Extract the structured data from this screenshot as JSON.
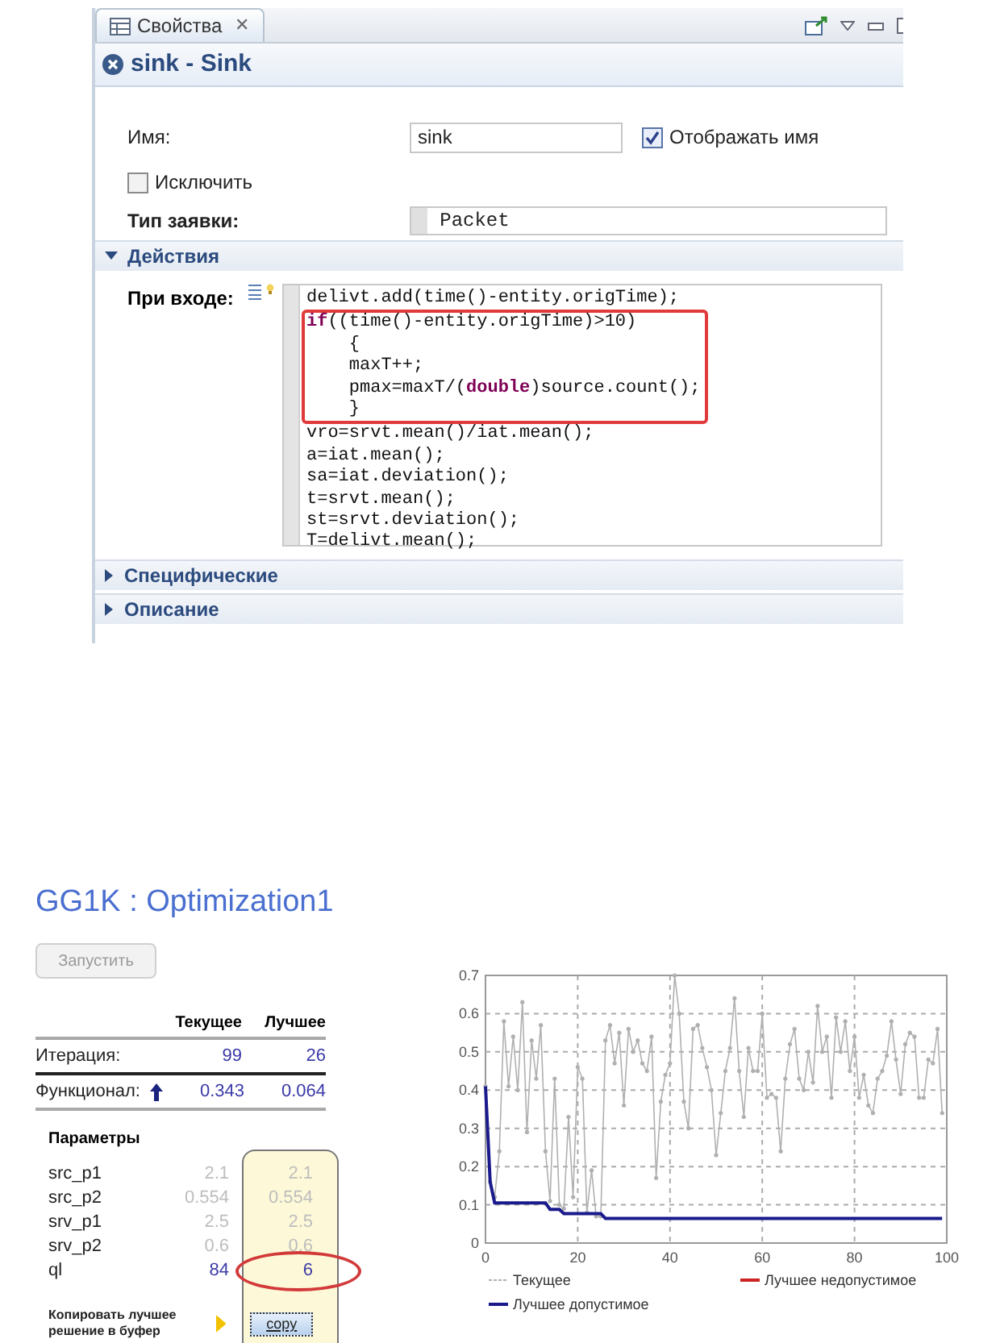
{
  "properties_view": {
    "tab": {
      "label": "Свойства",
      "close": "✕"
    },
    "header": {
      "title": "sink - Sink"
    },
    "fields": {
      "name_label": "Имя:",
      "name_value": "sink",
      "show_name": {
        "label": "Отображать имя",
        "checked": true
      },
      "exclude": {
        "label": "Исключить",
        "checked": false
      },
      "entity_type_label": "Тип заявки:",
      "entity_type_value": "Packet"
    },
    "sections": [
      {
        "title": "Действия",
        "expanded": true,
        "on_enter_label": "При входе:",
        "code_blocks": [
          {
            "highlighted": false,
            "lines": [
              "delivt.add(time()-entity.origTime);"
            ]
          },
          {
            "highlighted": true,
            "lines": [
              "**if**((time()-entity.origTime)>10)",
              "    {",
              "    maxT++;",
              "    pmax=maxT/(**double**)source.count();",
              "    }"
            ]
          },
          {
            "highlighted": false,
            "lines": [
              "vro=srvt.mean()/iat.mean();",
              "a=iat.mean();",
              "sa=iat.deviation();",
              "t=srvt.mean();",
              "st=srvt.deviation();",
              "T=delivt.mean();"
            ]
          }
        ]
      },
      {
        "title": "Специфические",
        "expanded": false
      },
      {
        "title": "Описание",
        "expanded": false
      }
    ]
  },
  "optimization": {
    "title": "GG1K : Optimization1",
    "run_button": {
      "label": "Запустить",
      "disabled": true
    },
    "columns": [
      "Текущее",
      "Лучшее"
    ],
    "stats": [
      {
        "label": "Итерация:",
        "current": "99",
        "best": "26"
      },
      {
        "label": "Функционал:",
        "current": "0.343",
        "best": "0.064"
      }
    ],
    "parameters_label": "Параметры",
    "parameters": [
      {
        "name": "src_p1",
        "current": "2.1",
        "best": "2.1",
        "dimmed": true,
        "circled": false
      },
      {
        "name": "src_p2",
        "current": "0.554",
        "best": "0.554",
        "dimmed": true,
        "circled": false
      },
      {
        "name": "srv_p1",
        "current": "2.5",
        "best": "2.5",
        "dimmed": true,
        "circled": false
      },
      {
        "name": "srv_p2",
        "current": "0.6",
        "best": "0.6",
        "dimmed": true,
        "circled": false
      },
      {
        "name": "ql",
        "current": "84",
        "best": "6",
        "dimmed": false,
        "circled": true
      }
    ],
    "copy_label": "Копировать лучшее решение в буфер",
    "copy_button": "copy",
    "chart_data": {
      "type": "line",
      "x": [
        0,
        1,
        2,
        3,
        4,
        5,
        6,
        7,
        8,
        9,
        10,
        11,
        12,
        13,
        14,
        15,
        16,
        17,
        18,
        19,
        20,
        21,
        22,
        23,
        24,
        25,
        26,
        27,
        28,
        29,
        30,
        31,
        32,
        33,
        34,
        35,
        36,
        37,
        38,
        39,
        40,
        41,
        42,
        43,
        44,
        45,
        46,
        47,
        48,
        49,
        50,
        51,
        52,
        53,
        54,
        55,
        56,
        57,
        58,
        59,
        60,
        61,
        62,
        63,
        64,
        65,
        66,
        67,
        68,
        69,
        70,
        71,
        72,
        73,
        74,
        75,
        76,
        77,
        78,
        79,
        80,
        81,
        82,
        83,
        84,
        85,
        86,
        87,
        88,
        89,
        90,
        91,
        92,
        93,
        94,
        95,
        96,
        97,
        98,
        99
      ],
      "series": [
        {
          "name": "Текущее",
          "color": "#b0b0b0",
          "values": [
            0.41,
            0.16,
            0.12,
            0.24,
            0.58,
            0.41,
            0.54,
            0.4,
            0.63,
            0.29,
            0.53,
            0.43,
            0.57,
            0.24,
            0.11,
            0.43,
            0.1,
            0.09,
            0.33,
            0.12,
            0.46,
            0.43,
            0.08,
            0.19,
            0.07,
            0.07,
            0.53,
            0.57,
            0.47,
            0.55,
            0.36,
            0.56,
            0.5,
            0.53,
            0.47,
            0.45,
            0.54,
            0.17,
            0.37,
            0.44,
            0.47,
            0.7,
            0.6,
            0.37,
            0.3,
            0.56,
            0.57,
            0.51,
            0.46,
            0.4,
            0.23,
            0.34,
            0.45,
            0.51,
            0.64,
            0.45,
            0.33,
            0.51,
            0.45,
            0.45,
            0.6,
            0.38,
            0.39,
            0.38,
            0.24,
            0.43,
            0.52,
            0.56,
            0.43,
            0.4,
            0.5,
            0.42,
            0.62,
            0.5,
            0.54,
            0.38,
            0.59,
            0.5,
            0.58,
            0.45,
            0.54,
            0.38,
            0.44,
            0.36,
            0.34,
            0.43,
            0.45,
            0.49,
            0.58,
            0.48,
            0.39,
            0.52,
            0.55,
            0.54,
            0.38,
            0.38,
            0.48,
            0.47,
            0.56,
            0.34
          ]
        },
        {
          "name": "Лучшее недопустимое",
          "color": "#cc2222",
          "values": [
            null,
            null,
            null,
            null,
            null,
            null,
            null,
            null,
            null,
            null,
            null,
            null,
            null,
            null,
            null,
            null,
            null,
            null,
            null,
            null,
            null,
            null,
            null,
            null,
            null,
            null,
            null,
            null,
            null,
            null,
            null,
            null,
            null,
            null,
            null,
            null,
            null,
            null,
            null,
            null,
            null,
            null,
            null,
            null,
            null,
            null,
            null,
            null,
            null,
            null,
            null,
            null,
            null,
            null,
            null,
            null,
            null,
            null,
            null,
            null,
            null,
            null,
            null,
            null,
            null,
            null,
            null,
            null,
            null,
            null,
            null,
            null,
            null,
            null,
            null,
            null,
            null,
            null,
            null,
            null,
            null,
            null,
            null,
            null,
            null,
            null,
            null,
            null,
            null,
            null,
            null,
            null,
            null,
            null,
            null,
            null,
            null,
            null,
            null,
            null
          ]
        },
        {
          "name": "Лучшее допустимое",
          "color": "#1a1a8c",
          "values": [
            0.41,
            0.16,
            0.105,
            0.105,
            0.105,
            0.105,
            0.105,
            0.105,
            0.105,
            0.105,
            0.105,
            0.105,
            0.105,
            0.105,
            0.088,
            0.088,
            0.088,
            0.077,
            0.077,
            0.077,
            0.077,
            0.077,
            0.077,
            0.077,
            0.077,
            0.077,
            0.064,
            0.064,
            0.064,
            0.064,
            0.064,
            0.064,
            0.064,
            0.064,
            0.064,
            0.064,
            0.064,
            0.064,
            0.064,
            0.064,
            0.064,
            0.064,
            0.064,
            0.064,
            0.064,
            0.064,
            0.064,
            0.064,
            0.064,
            0.064,
            0.064,
            0.064,
            0.064,
            0.064,
            0.064,
            0.064,
            0.064,
            0.064,
            0.064,
            0.064,
            0.064,
            0.064,
            0.064,
            0.064,
            0.064,
            0.064,
            0.064,
            0.064,
            0.064,
            0.064,
            0.064,
            0.064,
            0.064,
            0.064,
            0.064,
            0.064,
            0.064,
            0.064,
            0.064,
            0.064,
            0.064,
            0.064,
            0.064,
            0.064,
            0.064,
            0.064,
            0.064,
            0.064,
            0.064,
            0.064,
            0.064,
            0.064,
            0.064,
            0.064,
            0.064,
            0.064,
            0.064,
            0.064,
            0.064,
            0.064
          ]
        }
      ],
      "grid": true,
      "legend": true,
      "xlim": [
        0,
        100
      ],
      "ylim": [
        0,
        0.7
      ],
      "xticks": [
        0,
        20,
        40,
        60,
        80,
        100
      ],
      "yticks": [
        0,
        0.1,
        0.2,
        0.3,
        0.4,
        0.5,
        0.6,
        0.7
      ]
    }
  }
}
